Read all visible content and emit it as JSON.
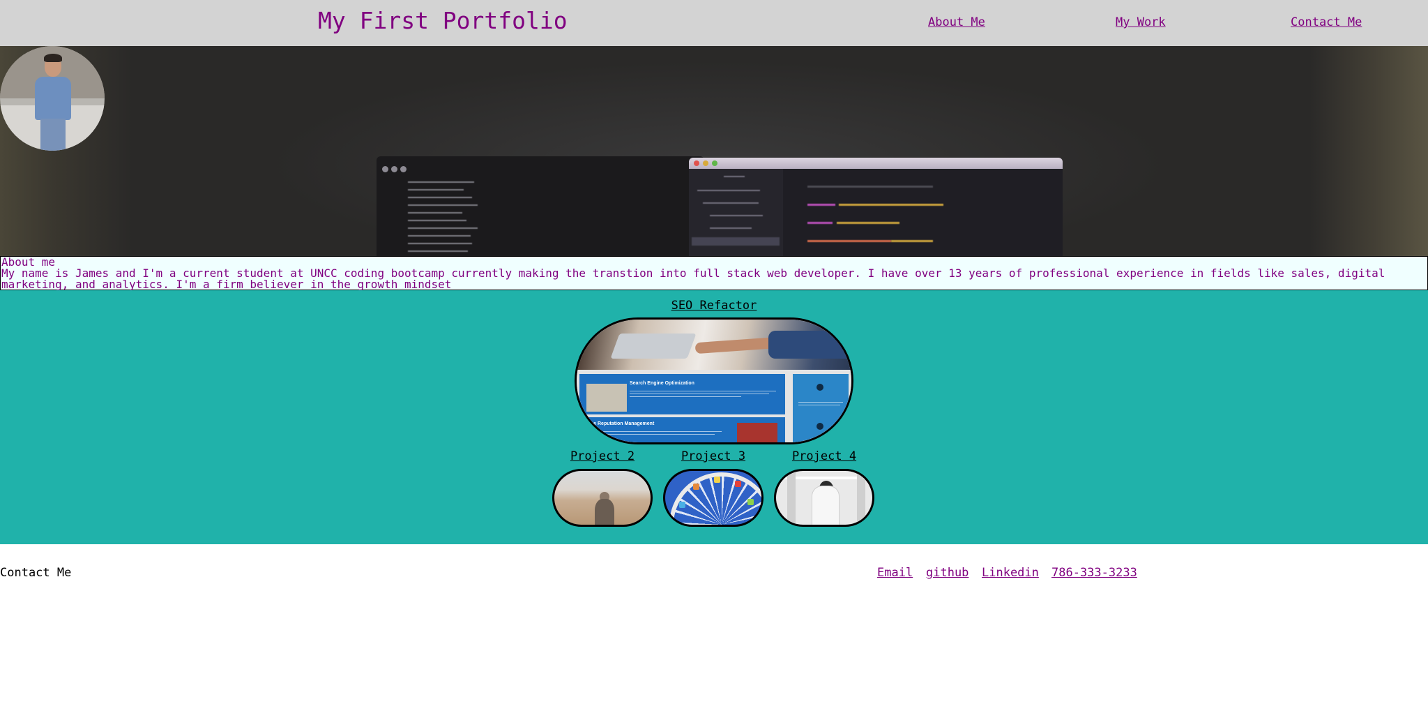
{
  "header": {
    "title": "My First Portfolio",
    "nav": [
      "About Me",
      "My Work",
      "Contact Me"
    ]
  },
  "hero": {
    "avatar": "profile photo of James"
  },
  "about": {
    "heading": "About me",
    "text": "My name is James and I'm a current student at UNCC coding bootcamp currently making the transtion into full stack web developer. I have over 13 years of professional experience in fields like sales, digital marketing, and analytics. I'm a firm believer in the growth mindset"
  },
  "work": {
    "featured": {
      "label": "SEO Refactor",
      "preview_heading_1": "Search Engine Optimization",
      "preview_heading_2": "line Reputation Management"
    },
    "projects": [
      {
        "label": "Project 2"
      },
      {
        "label": "Project 3"
      },
      {
        "label": "Project 4"
      }
    ]
  },
  "contact": {
    "heading": "Contact Me",
    "links": [
      "Email",
      "github",
      "Linkedin",
      "786-333-3233"
    ]
  },
  "colors": {
    "header_bg": "#d3d3d3",
    "accent": "#800080",
    "work_bg": "#20b2aa",
    "about_bg": "#f0ffff"
  }
}
